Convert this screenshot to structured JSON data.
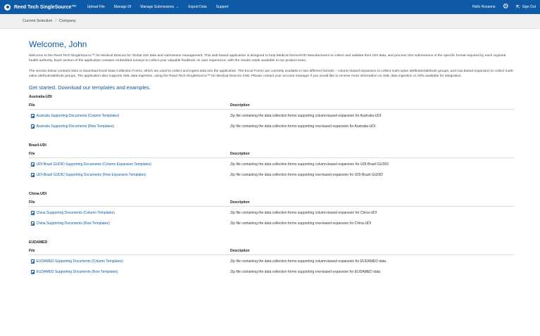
{
  "nav": {
    "brand": "Reed Tech SingleSource™",
    "items": [
      "Upload File",
      "Manage DI",
      "Manage Submissions",
      "Export Data",
      "Support"
    ],
    "hello": "Hello Roxanne",
    "signout": "Sign Out"
  },
  "breadcrumb": {
    "items": [
      "Current Selection",
      "Company"
    ]
  },
  "main": {
    "title": "Welcome, John",
    "para1": "Welcome to the Reed Tech SingleSource™ for Medical Devices for Global UDI data and submission management. This web-based application is designed to help Medical Device/IVD Manufacturers to collect and validate their UDI data, and process UDI submissions in the specific format required by each regional health authority. Each section of the application contains embedded surveys to collect your valuable feedback on user experience, with the results made available to our product team.",
    "para2": "The section below contains links to download Excel Data Collection Forms, which are used to collect and ingest data into the application. The Excel Forms are currently available in two different formats – column-based expansion to collect multi-value attributes/attribute groups, and row-based expansion to collect multi-value attribute/attribute groups. The application also supports XML data ingestion, using the Reed Tech SingleSource™ for Medical Devices XSD. Please contact your account manager if you would like to receive more information on XML data ingestion or APIs available for integration.",
    "get_started": "Get started. Download our templates and examples.",
    "col_file": "File",
    "col_desc": "Description"
  },
  "sections": [
    {
      "title": "Australia-UDI",
      "rows": [
        {
          "file": "Australia Supporting Documents (Column Templates)",
          "desc": "Zip file containing the data collection forms supporting column-based expansion for Australia-UDI"
        },
        {
          "file": "Australia Supporting Documents (Row Templates)",
          "desc": "Zip file containing the data collection forms supporting row-based expansion for Australia-UDI"
        }
      ]
    },
    {
      "title": "Brazil-UDI",
      "rows": [
        {
          "file": "UDI-Brazil GUDID Supporting Documents (Column Expansion Templates)",
          "desc": "Zip file containing the data collection forms supporting column-based expansion for UDI-Brazil GUDID"
        },
        {
          "file": "UDI-Brazil GUDID Supporting Documents (Row Expansion Templates)",
          "desc": "Zip file containing the data collection forms supporting row-based expansion for UDI-Brazil GUDID"
        }
      ]
    },
    {
      "title": "China-UDI",
      "rows": [
        {
          "file": "China Supporting Documents (Column Templates)",
          "desc": "Zip file containing the data collection forms supporting column-based expansion for China-UDI"
        },
        {
          "file": "China Supporting Documents (Row Templates)",
          "desc": "Zip file containing the data collection forms supporting row-based expansion for China-UDI"
        }
      ]
    },
    {
      "title": "EUDAMED",
      "rows": [
        {
          "file": "EUDAMED Supporting Documents (Column Templates)",
          "desc": "Zip file containing the data collection forms supporting column-based expansion for EUDAMED data."
        },
        {
          "file": "EUDAMED Supporting Documents (Row Templates)",
          "desc": "Zip file containing the data collection forms supporting row-based expansion for EUDAMED data."
        }
      ]
    }
  ]
}
